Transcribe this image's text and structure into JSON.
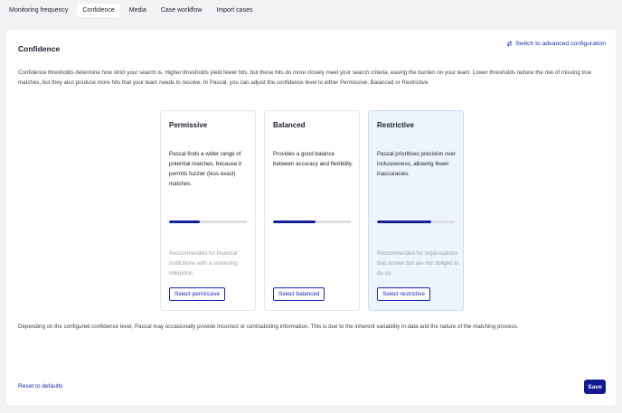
{
  "tabs": [
    {
      "label": "Monitoring frequency",
      "active": false
    },
    {
      "label": "Confidence",
      "active": true
    },
    {
      "label": "Media",
      "active": false
    },
    {
      "label": "Case workflow",
      "active": false
    },
    {
      "label": "Import cases",
      "active": false
    }
  ],
  "panel": {
    "title": "Confidence",
    "advanced_link": "Switch to advanced configuration",
    "advanced_icon": "swap-icon",
    "intro": "Confidence thresholds determine how strict your search is. Higher thresholds yield fewer hits, but these hits do more closely meet your search criteria, easing the burden on your team. Lower thresholds reduce the risk of missing true matches, but they also produce more hits that your team needs to resolve. In Pascal, you can adjust the confidence level to either Permissive, Balanced or Restrictive.",
    "disclaimer": "Depending on the configured confidence level, Pascal may occasionally provide incorrect or contradicting information. This is due to the inherent variability in data and the nature of the matching process.",
    "reset_label": "Reset to defaults",
    "save_label": "Save"
  },
  "cards": [
    {
      "title": "Permissive",
      "description": "Pascal finds a wider range of potential matches, because it permits fuzzier (less exact) matches.",
      "level": 0.4,
      "recommendation": "Recommended for financial institutions with a screening obligation.",
      "button": "Select permissive",
      "selected": false
    },
    {
      "title": "Balanced",
      "description": "Provides a good balance between accuracy and flexibility.",
      "level": 0.55,
      "recommendation": "",
      "button": "Select balanced",
      "selected": false
    },
    {
      "title": "Restrictive",
      "description": "Pascal prioritises precision over inclusiveness, allowing fewer inaccuracies.",
      "level": 0.7,
      "recommendation": "Recommended for organisations that screen but are not obliged to do so.",
      "button": "Select restrictive",
      "selected": true
    }
  ],
  "colors": {
    "accent": "#1a2bb0",
    "bar_fill": "#132195",
    "selected_card_bg": "#eef4fd",
    "save_bg": "#0f1a8f"
  }
}
